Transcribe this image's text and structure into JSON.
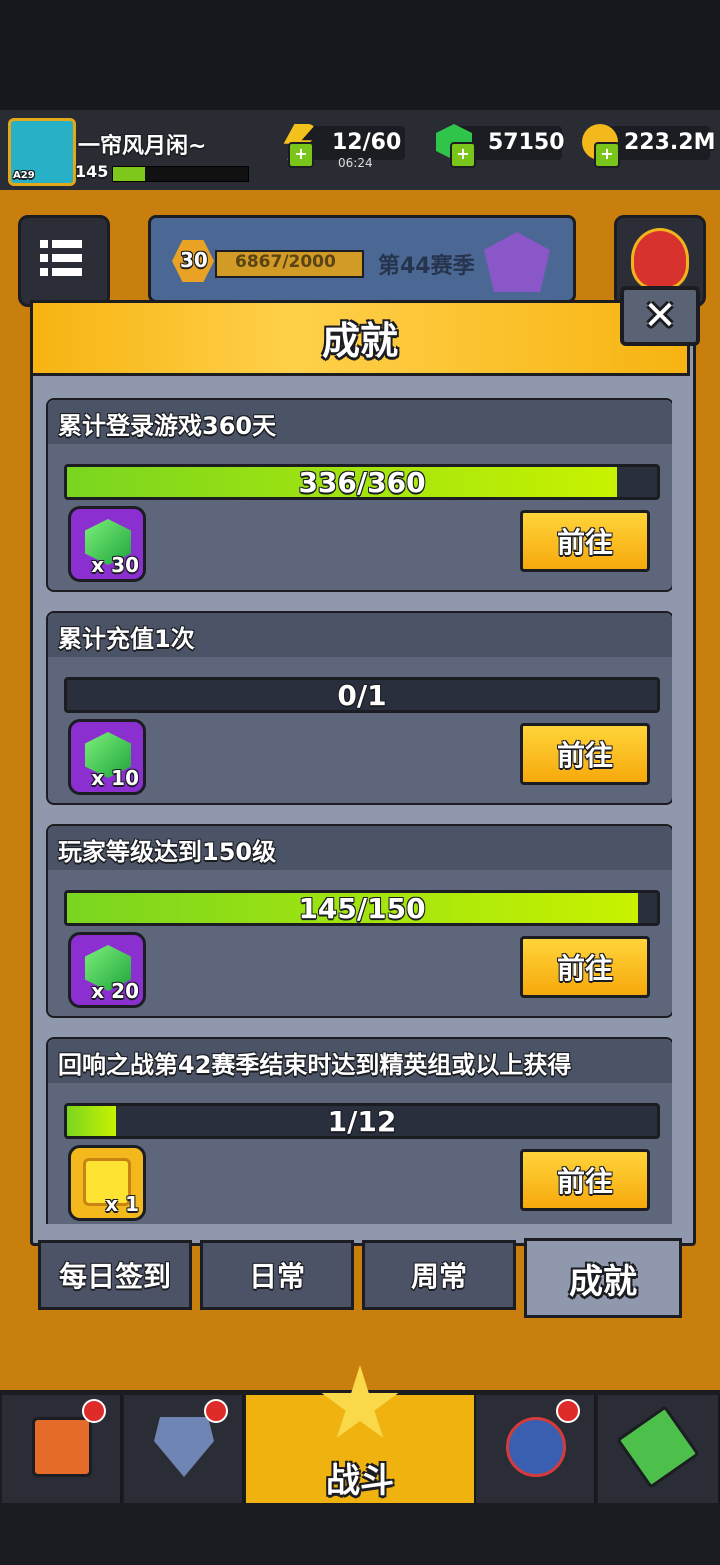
{
  "header": {
    "player_name": "一帘风月闲~",
    "avatar_tag": "A29",
    "level": "145",
    "energy": "12/60",
    "energy_timer": "06:24",
    "gems": "57150",
    "gold": "223.2M"
  },
  "season": {
    "rank_level": "30",
    "progress": "6867/2000",
    "label": "第44赛季"
  },
  "dialog": {
    "title": "成就",
    "close_label": "✕",
    "go_label": "前往",
    "items": [
      {
        "title": "累计登录游戏360天",
        "progress_text": "336/360",
        "progress": 0.933,
        "reward_type": "gem",
        "reward_qty": "x 30"
      },
      {
        "title": "累计充值1次",
        "progress_text": "0/1",
        "progress": 0.0,
        "reward_type": "gem",
        "reward_qty": "x 10"
      },
      {
        "title": "玩家等级达到150级",
        "progress_text": "145/150",
        "progress": 0.967,
        "reward_type": "gem",
        "reward_qty": "x 20"
      },
      {
        "title": "回响之战第42赛季结束时达到精英组或以上获得",
        "progress_text": "1/12",
        "progress": 0.083,
        "reward_type": "frame",
        "reward_qty": "x 1"
      }
    ]
  },
  "tabs": [
    {
      "label": "每日签到",
      "active": false
    },
    {
      "label": "日常",
      "active": false
    },
    {
      "label": "周常",
      "active": false
    },
    {
      "label": "成就",
      "active": true
    }
  ],
  "bottom_nav": {
    "battle_label": "战斗",
    "icons": [
      "shop-icon",
      "badge-icon",
      "battle-icon",
      "medal-icon",
      "pass-icon"
    ]
  },
  "colors": {
    "accent": "#f7b412",
    "progress": "#a6e60e",
    "panel": "#5d667a"
  }
}
